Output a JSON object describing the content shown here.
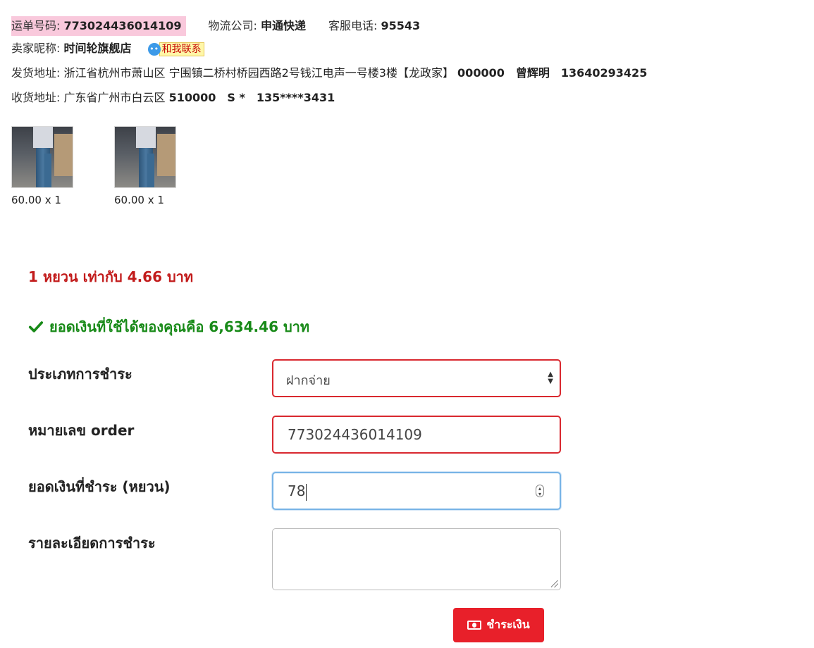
{
  "shipment": {
    "waybill_label": "运单号码:",
    "waybill_number": "773024436014109",
    "courier_label": "物流公司:",
    "courier_name": "申通快递",
    "phone_label": "客服电话:",
    "phone_number": "95543",
    "seller_label": "卖家昵称:",
    "seller_name": "时间轮旗舰店",
    "contact_label": "和我联系",
    "sender_label": "发货地址:",
    "sender_address": "浙江省杭州市萧山区 宁围镇二桥村桥园西路2号钱江电声一号楼3楼【龙政家】",
    "sender_postcode": "000000",
    "sender_name": "曾辉明",
    "sender_phone": "13640293425",
    "receiver_label": "收货地址:",
    "receiver_address": "广东省广州市白云区",
    "receiver_postcode": "510000",
    "receiver_name": "S *",
    "receiver_phone": "135****3431"
  },
  "products": [
    {
      "price_qty": "60.00 x 1"
    },
    {
      "price_qty": "60.00 x 1"
    }
  ],
  "payment": {
    "exchange_rate": "1 หยวน เท่ากับ 4.66 บาท",
    "balance": "ยอดเงินที่ใช้ได้ของคุณคือ 6,634.46 บาท",
    "type_label": "ประเภทการชำระ",
    "type_value": "ฝากจ่าย",
    "order_label": "หมายเลข order",
    "order_value": "773024436014109",
    "amount_label": "ยอดเงินที่ชำระ (หยวน)",
    "amount_value": "78",
    "details_label": "รายละเอียดการชำระ",
    "details_value": "",
    "pay_button": "ชำระเงิน"
  },
  "colors": {
    "error_border": "#d9282f",
    "focus_border": "#77b3e6",
    "rate_text": "#c21b1b",
    "balance_text": "#188a18",
    "pay_button": "#e8202a",
    "waybill_highlight": "#f9c9dc"
  },
  "icons": {
    "contact": "chat-bubble-icon",
    "balance": "checkmark-icon",
    "select": "select-arrows-icon",
    "spinner": "number-spinner-icon",
    "pay": "money-icon"
  }
}
